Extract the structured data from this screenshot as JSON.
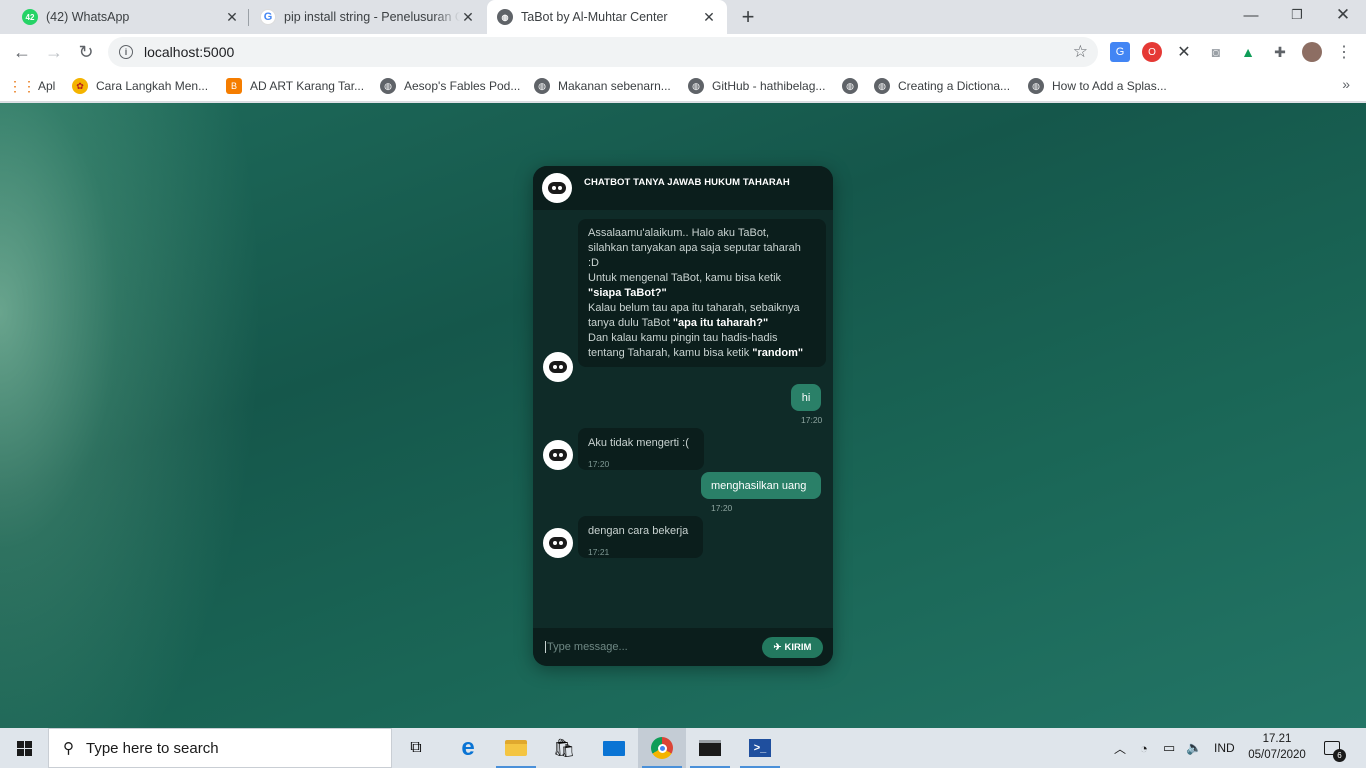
{
  "browser": {
    "tabs": [
      {
        "label": "(42) WhatsApp",
        "badge": "42",
        "favicon": "whatsapp-icon"
      },
      {
        "label": "pip install string - Penelusuran Google",
        "favicon": "google-icon"
      },
      {
        "label": "TaBot by Al-Muhtar Center",
        "favicon": "globe-icon"
      }
    ],
    "url": "localhost:5000",
    "bookmarks": [
      {
        "label": "Apl",
        "icon": "apps-grid-icon"
      },
      {
        "label": "Cara Langkah Men...",
        "icon": "site-icon"
      },
      {
        "label": "AD ART Karang Tar...",
        "icon": "blogger-icon"
      },
      {
        "label": "Aesop's Fables Pod...",
        "icon": "globe-icon"
      },
      {
        "label": "Makanan sebenarn...",
        "icon": "globe-icon"
      },
      {
        "label": "GitHub - hathibelag...",
        "icon": "globe-icon"
      },
      {
        "label": "",
        "icon": "globe-icon"
      },
      {
        "label": "Creating a Dictiona...",
        "icon": "globe-icon"
      },
      {
        "label": "How to Add a Splas...",
        "icon": "globe-icon"
      }
    ]
  },
  "chat": {
    "title": "CHATBOT TANYA JAWAB HUKUM TAHARAH",
    "welcome": {
      "l1": "Assalaamu'alaikum.. Halo aku TaBot,",
      "l2": "silahkan tanyakan apa saja seputar taharah",
      "l3": ":D",
      "l4": "Untuk mengenal TaBot, kamu bisa ketik",
      "l5": "\"siapa TaBot?\"",
      "l6": "Kalau belum tau apa itu taharah, sebaiknya",
      "l7a": "tanya dulu TaBot ",
      "l7b": "\"apa itu taharah?\"",
      "l8": "Dan kalau kamu pingin tau hadis-hadis",
      "l9a": "tentang Taharah, kamu bisa ketik ",
      "l9b": "\"random\""
    },
    "messages": [
      {
        "sender": "user",
        "text": "hi",
        "time": "17:20"
      },
      {
        "sender": "bot",
        "text": "Aku tidak mengerti :(",
        "time": "17:20"
      },
      {
        "sender": "user",
        "text": "menghasilkan uang",
        "time": "17:20"
      },
      {
        "sender": "bot",
        "text": "dengan cara bekerja",
        "time": "17:21"
      }
    ],
    "input_placeholder": "Type message...",
    "send_label": "KIRIM"
  },
  "taskbar": {
    "search_placeholder": "Type here to search",
    "language": "IND",
    "time": "17.21",
    "date": "05/07/2020",
    "notification_count": "6"
  }
}
